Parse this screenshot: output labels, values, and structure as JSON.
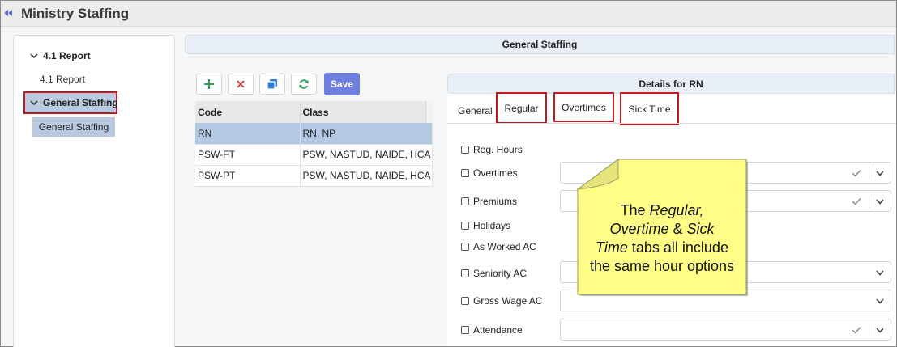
{
  "app": {
    "title": "Ministry Staffing"
  },
  "sidebar": {
    "items": [
      {
        "label": "4.1 Report"
      },
      {
        "label": "4.1 Report"
      },
      {
        "label": "General Staffing"
      },
      {
        "label": "General Staffing"
      }
    ]
  },
  "main": {
    "header": "General Staffing",
    "toolbar": {
      "save_label": "Save"
    },
    "table": {
      "columns": [
        "Code",
        "Class"
      ],
      "rows": [
        {
          "code": "RN",
          "class": "RN, NP",
          "selected": true
        },
        {
          "code": "PSW-FT",
          "class": "PSW, NASTUD, NAIDE, HCA"
        },
        {
          "code": "PSW-PT",
          "class": "PSW, NASTUD, NAIDE, HCA"
        }
      ]
    }
  },
  "details": {
    "header": "Details for RN",
    "tabs": [
      {
        "label": "General"
      },
      {
        "label": "Regular"
      },
      {
        "label": "Overtimes"
      },
      {
        "label": "Sick Time"
      }
    ],
    "options": [
      {
        "label": "Reg. Hours"
      },
      {
        "label": "Overtimes"
      },
      {
        "label": "Premiums"
      },
      {
        "label": "Holidays"
      },
      {
        "label": "As Worked AC"
      },
      {
        "label": "Seniority AC"
      },
      {
        "label": "Gross Wage AC"
      },
      {
        "label": "Attendance"
      }
    ]
  },
  "note": {
    "line1a": "The ",
    "line1b": "Regular,",
    "line2": "Overtime",
    "line2b": " & ",
    "line2c": "Sick",
    "line3a": "Time",
    "line3b": " tabs all include",
    "line4": "the same hour options"
  },
  "colors": {
    "accent": "#6f7fe0",
    "highlight_border": "#c0191f",
    "selected_row": "#b3c8e3",
    "note_fill": "#ffff88"
  }
}
